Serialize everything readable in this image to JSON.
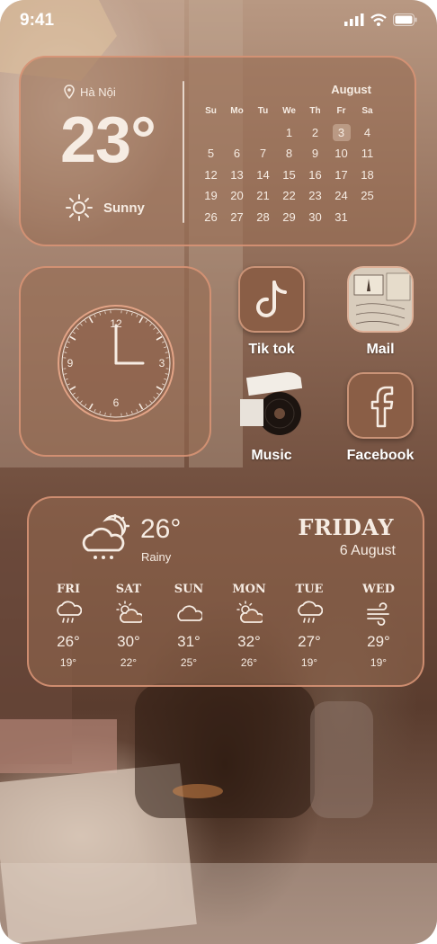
{
  "status_bar": {
    "time": "9:41"
  },
  "weather_calendar": {
    "location": "Hà Nội",
    "temperature": "23°",
    "condition": "Sunny",
    "calendar": {
      "month": "August",
      "weekdays": [
        "Su",
        "Mo",
        "Tu",
        "We",
        "Th",
        "Fr",
        "Sa"
      ],
      "days": [
        "",
        "",
        "",
        "1",
        "2",
        "3",
        "4",
        "5",
        "6",
        "7",
        "8",
        "9",
        "10",
        "11",
        "12",
        "13",
        "14",
        "15",
        "16",
        "17",
        "18",
        "19",
        "20",
        "21",
        "22",
        "23",
        "24",
        "25",
        "26",
        "27",
        "28",
        "29",
        "30",
        "31",
        "",
        ""
      ],
      "today": "3"
    }
  },
  "clock": {
    "numerals": [
      "12",
      "3",
      "6",
      "9"
    ],
    "hour": 3,
    "minute": 0
  },
  "apps": [
    {
      "label": "Tik tok",
      "icon": "tiktok-icon"
    },
    {
      "label": "Mail",
      "icon": "mail-icon"
    },
    {
      "label": "Music",
      "icon": "music-icon"
    },
    {
      "label": "Facebook",
      "icon": "facebook-icon"
    }
  ],
  "forecast": {
    "current_temp": "26°",
    "current_condition": "Rainy",
    "day": "FRIDAY",
    "date": "6 August",
    "days": [
      {
        "day": "FRI",
        "icon": "rain-icon",
        "high": "26°",
        "low": "19°"
      },
      {
        "day": "SAT",
        "icon": "sun-cloud-icon",
        "high": "30°",
        "low": "22°"
      },
      {
        "day": "SUN",
        "icon": "cloud-icon",
        "high": "31°",
        "low": "25°"
      },
      {
        "day": "MON",
        "icon": "sun-cloud-icon",
        "high": "32°",
        "low": "26°"
      },
      {
        "day": "TUE",
        "icon": "rain-icon",
        "high": "27°",
        "low": "19°"
      },
      {
        "day": "WED",
        "icon": "wind-icon",
        "high": "29°",
        "low": "19°"
      }
    ]
  }
}
